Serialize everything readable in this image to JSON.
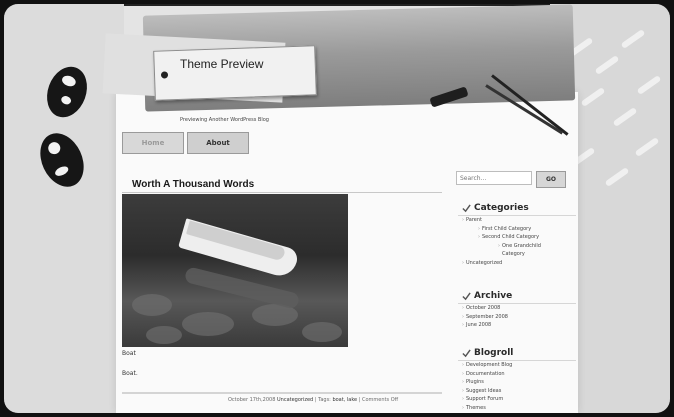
{
  "site": {
    "title": "Theme Preview",
    "description": "Previewing Another WordPress Blog"
  },
  "nav": {
    "items": [
      {
        "label": "Home"
      },
      {
        "label": "About"
      }
    ]
  },
  "post": {
    "title": "Worth A Thousand Words",
    "caption": "Boat",
    "excerpt": "Boat.",
    "meta": {
      "date": "October 17th,2008",
      "category": "Uncategorized",
      "tags_label": "| Tags:",
      "tags": "boat, lake",
      "comments": "| Comments Off"
    }
  },
  "search": {
    "placeholder": "Search...",
    "button_label": "GO"
  },
  "sidebar": {
    "categories": {
      "title": "Categories",
      "items": [
        {
          "label": "Parent"
        },
        {
          "label": "First Child Category"
        },
        {
          "label": "Second Child Category"
        },
        {
          "label": "One Grandchild"
        },
        {
          "label": "Category"
        },
        {
          "label": "Uncategorized"
        }
      ]
    },
    "archive": {
      "title": "Archive",
      "items": [
        {
          "label": "October 2008"
        },
        {
          "label": "September 2008"
        },
        {
          "label": "June 2008"
        }
      ]
    },
    "blogroll": {
      "title": "Blogroll",
      "items": [
        {
          "label": "Development Blog"
        },
        {
          "label": "Documentation"
        },
        {
          "label": "Plugins"
        },
        {
          "label": "Suggest Ideas"
        },
        {
          "label": "Support Forum"
        },
        {
          "label": "Themes"
        }
      ]
    }
  },
  "icons": {
    "widget_bullet": "checkmark-icon",
    "list_bullet": "chevron-right-icon"
  }
}
